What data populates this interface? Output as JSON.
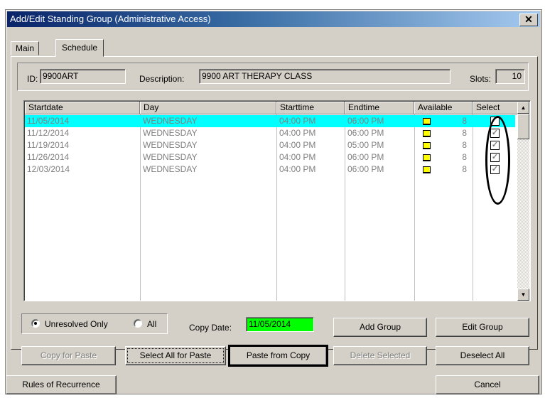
{
  "window": {
    "title": "Add/Edit Standing Group (Administrative Access)",
    "close_glyph": "✕"
  },
  "tabs": [
    {
      "label": "Main"
    },
    {
      "label": "Schedule"
    }
  ],
  "header": {
    "id_label": "ID:",
    "id_value": "9900ART",
    "desc_label": "Description:",
    "desc_value": "9900 ART THERAPY CLASS",
    "slots_label": "Slots:",
    "slots_value": "10"
  },
  "grid": {
    "columns": [
      "Startdate",
      "Day",
      "Starttime",
      "Endtime",
      "Available",
      "Select"
    ],
    "rows": [
      {
        "startdate": "11/05/2014",
        "day": "WEDNESDAY",
        "starttime": "04:00 PM",
        "endtime": "06:00 PM",
        "available": "8",
        "select": ""
      },
      {
        "startdate": "11/12/2014",
        "day": "WEDNESDAY",
        "starttime": "04:00 PM",
        "endtime": "06:00 PM",
        "available": "8",
        "select": "✓"
      },
      {
        "startdate": "11/19/2014",
        "day": "WEDNESDAY",
        "starttime": "04:00 PM",
        "endtime": "05:00 PM",
        "available": "8",
        "select": "✓"
      },
      {
        "startdate": "11/26/2014",
        "day": "WEDNESDAY",
        "starttime": "04:00 PM",
        "endtime": "06:00 PM",
        "available": "8",
        "select": "✓"
      },
      {
        "startdate": "12/03/2014",
        "day": "WEDNESDAY",
        "starttime": "04:00 PM",
        "endtime": "06:00 PM",
        "available": "8",
        "select": "✓"
      }
    ],
    "up_arrow": "▲",
    "down_arrow": "▼"
  },
  "filter": {
    "unresolved_label": "Unresolved Only",
    "all_label": "All"
  },
  "copy_date": {
    "label": "Copy Date:",
    "value": "11/05/2014"
  },
  "buttons": {
    "add_group": "Add Group",
    "edit_group": "Edit Group",
    "copy_for_paste": "Copy for Paste",
    "select_all_for_paste": "Select All for Paste",
    "paste_from_copy": "Paste from Copy",
    "delete_selected": "Delete Selected",
    "deselect_all": "Deselect All",
    "rules_of_recurrence": "Rules of Recurrence",
    "cancel": "Cancel"
  },
  "colors": {
    "selected_row": "#00ffff",
    "available_indicator": "#ffff00",
    "copy_date_bg": "#00ff00"
  }
}
